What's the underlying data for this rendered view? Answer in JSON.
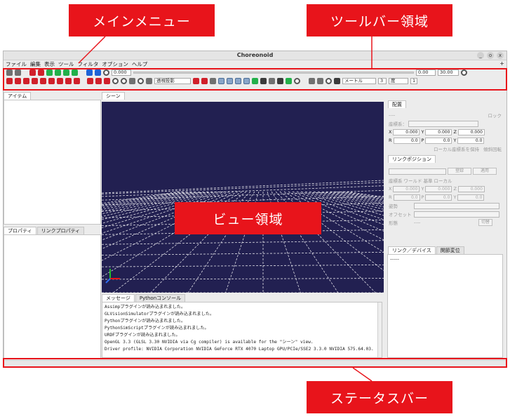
{
  "annotations": {
    "main_menu": "メインメニュー",
    "toolbar_area": "ツールバー領域",
    "view_area": "ビュー領域",
    "status_bar": "ステータスバー"
  },
  "colors": {
    "annotation": "#e8141b",
    "scene_bg": "#222051",
    "grid": "#ffffff"
  },
  "window": {
    "title": "Choreonoid",
    "buttons": [
      "_",
      "o",
      "x"
    ]
  },
  "menu": {
    "items": [
      "ファイル",
      "編集",
      "表示",
      "ツール",
      "フィルタ",
      "オプション",
      "ヘルプ"
    ],
    "extra": "+"
  },
  "toolbar": {
    "time_value": "0.000",
    "time_start": "0.00",
    "time_end": "30.00",
    "projection": "透視投影",
    "unit": "メートル",
    "decimals": "3",
    "angle_unit": "度",
    "step": "1"
  },
  "panels": {
    "items_tab": "アイテム",
    "scene_tab": "シーン",
    "properties_tabs": [
      "プロパティ",
      "リンクプロパティ"
    ],
    "message_tabs": [
      "メッセージ",
      "Pythonコンソール"
    ]
  },
  "messages": [
    "Assimpプラグインが読み込まれました。",
    "GLVisionSimulatorプラグインが読み込まれました。",
    "Pythonプラグインが読み込まれました。",
    "PythonSimScriptプラグインが読み込まれました。",
    "URDFプラグインが読み込まれました。",
    "OpenGL 3.3 (GLSL 3.30 NVIDIA via Cg compiler) is available for the \"シーン\" view.",
    "Driver profile: NVIDIA Corporation NVIDIA GeForce RTX 4070 Laptop GPU/PCIe/SSE2 3.3.0 NVIDIA 575.64.03."
  ],
  "placement": {
    "tab": "配置",
    "name": "----",
    "lock": "ロック",
    "coord_label": "座標系：",
    "x_label": "X",
    "y_label": "Y",
    "z_label": "Z",
    "r_label": "R",
    "p_label": "P",
    "yw_label": "Y",
    "x": "0.000",
    "y": "0.000",
    "z": "0.000",
    "r": "0.0",
    "p": "0.0",
    "yw": "0.0",
    "keep_local": "ローカル座標系を保持",
    "display_rot": "傾斜回転"
  },
  "link_position": {
    "tab": "リンクポジション",
    "apply_label": "適用",
    "mode_label": "座標系",
    "world": "ワールド",
    "base": "基準",
    "local": "ローカル",
    "x": "0.000",
    "y": "0.000",
    "z": "0.000",
    "r": "0.0",
    "p": "0.0",
    "yw": "0.0",
    "config_label": "姿勢",
    "offset_label": "オフセット",
    "ik_label": "形態",
    "ik_value": "----",
    "switch": "切替",
    "register": "登録"
  },
  "link_device": {
    "tabs": [
      "リンク／デバイス",
      "関節変位"
    ],
    "value": "------"
  }
}
